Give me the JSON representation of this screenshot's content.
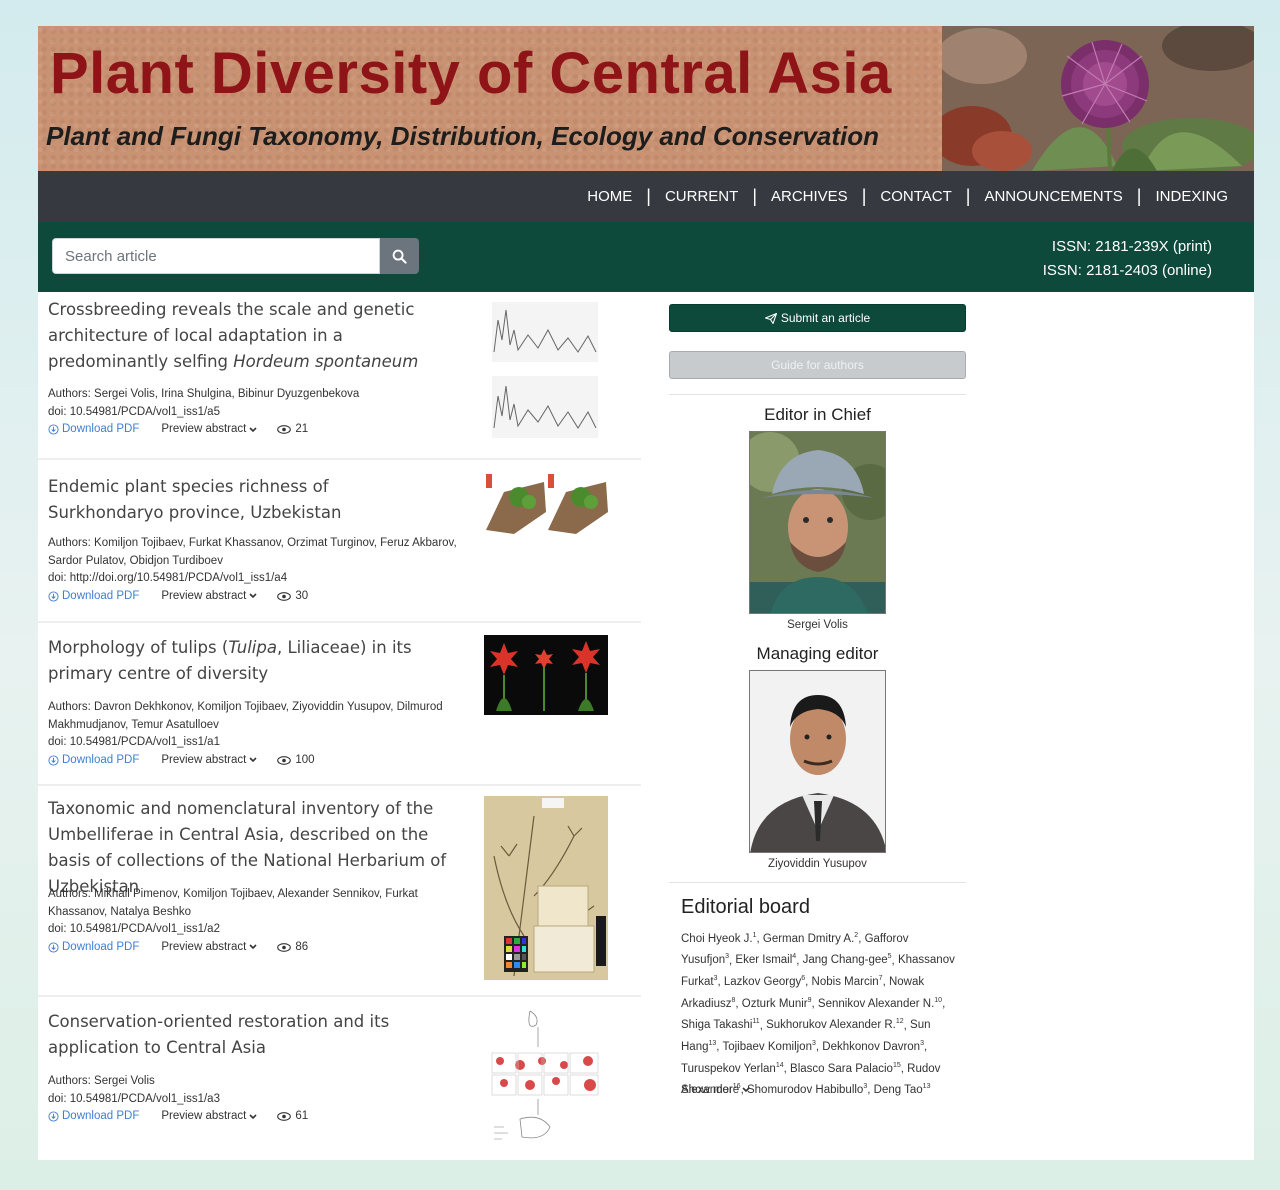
{
  "banner": {
    "title": "Plant Diversity of Central Asia",
    "subtitle": "Plant and Fungi Taxonomy, Distribution, Ecology and Conservation"
  },
  "nav": {
    "items": [
      "HOME",
      "CURRENT",
      "ARCHIVES",
      "CONTACT",
      "ANNOUNCEMENTS",
      "INDEXING"
    ],
    "separator": "|"
  },
  "search": {
    "placeholder": "Search article",
    "icon": "search-icon"
  },
  "issn": {
    "print": "ISSN: 2181-239X (print)",
    "online": "ISSN: 2181-2403 (online)"
  },
  "article_actions": {
    "download": "Download PDF",
    "preview": "Preview abstract"
  },
  "articles": [
    {
      "title_parts": [
        "Crossbreeding reveals the scale and genetic architecture of local adaptation in a predominantly selfing ",
        "Hordeum spontaneum",
        ""
      ],
      "authors": "Authors: Sergei Volis, Irina Shulgina, Bibinur Dyuzgenbekova",
      "doi": "doi: 10.54981/PCDA/vol1_iss1/a5",
      "views": "21"
    },
    {
      "title_parts": [
        "Endemic plant species richness of Surkhondaryo province, Uzbekistan",
        "",
        ""
      ],
      "authors": "Authors: Komiljon Tojibaev, Furkat Khassanov, Orzimat Turginov, Feruz Akbarov, Sardor Pulatov, Obidjon Turdiboev",
      "doi": "doi: http://doi.org/10.54981/PCDA/vol1_iss1/a4",
      "views": "30"
    },
    {
      "title_parts": [
        "Morphology of tulips (",
        "Tulipa",
        ", Liliaceae) in its primary centre of diversity"
      ],
      "authors": "Authors: Davron Dekhkonov, Komiljon Tojibaev, Ziyoviddin Yusupov, Dilmurod Makhmudjanov, Temur Asatulloev",
      "doi": "doi: 10.54981/PCDA/vol1_iss1/a1",
      "views": "100"
    },
    {
      "title_parts": [
        "Taxonomic and nomenclatural inventory of the Umbelliferae in Central Asia, described on the basis of collections of the National Herbarium of Uzbekistan",
        "",
        ""
      ],
      "authors": "Authors: Mikhail Pimenov, Komiljon Tojibaev, Alexander Sennikov, Furkat Khassanov, Natalya Beshko",
      "doi": "doi: 10.54981/PCDA/vol1_iss1/a2",
      "views": "86"
    },
    {
      "title_parts": [
        "Conservation-oriented restoration and its application to Central Asia",
        "",
        ""
      ],
      "authors": "Authors: Sergei Volis",
      "doi": "doi: 10.54981/PCDA/vol1_iss1/a3",
      "views": "61"
    }
  ],
  "sidebar": {
    "submit_label": "Submit an article",
    "guide_label": "Guide for authors",
    "editor_in_chief_heading": "Editor in Chief",
    "editor_in_chief_name": "Sergei Volis",
    "managing_editor_heading": "Managing editor",
    "managing_editor_name": "Ziyoviddin Yusupov",
    "editorial_board_heading": "Editorial board",
    "editorial_board_members": [
      [
        "Choi Hyeok J.",
        "1"
      ],
      [
        "German Dmitry A.",
        "2"
      ],
      [
        "Gafforov Yusufjon",
        "3"
      ],
      [
        "Eker Ismail",
        "4"
      ],
      [
        "Jang Chang-gee",
        "5"
      ],
      [
        "Khassanov Furkat",
        "3"
      ],
      [
        "Lazkov Georgy",
        "6"
      ],
      [
        "Nobis Marcin",
        "7"
      ],
      [
        "Nowak Arkadiusz",
        "8"
      ],
      [
        "Ozturk Munir",
        "9"
      ],
      [
        "Sennikov Alexander N.",
        "10"
      ],
      [
        "Shiga Takashi",
        "11"
      ],
      [
        "Sukhorukov Alexander R.",
        "12"
      ],
      [
        "Sun Hang",
        "13"
      ],
      [
        "Tojibaev Komiljon",
        "3"
      ],
      [
        "Dekhkonov Davron",
        "3"
      ],
      [
        "Turuspekov Yerlan",
        "14"
      ],
      [
        "Blasco Sara Palacio",
        "15"
      ],
      [
        "Rudov Alexander",
        "16"
      ],
      [
        "Shomurodov Habibullo",
        "3"
      ],
      [
        "Deng Tao",
        "13"
      ]
    ],
    "show_more_label": "Show more"
  },
  "colors": {
    "banner_bg": "#c99272",
    "banner_title": "#8e1418",
    "navbar_bg": "#363a40",
    "green": "#0d4a3b",
    "link": "#3d7fd6"
  }
}
